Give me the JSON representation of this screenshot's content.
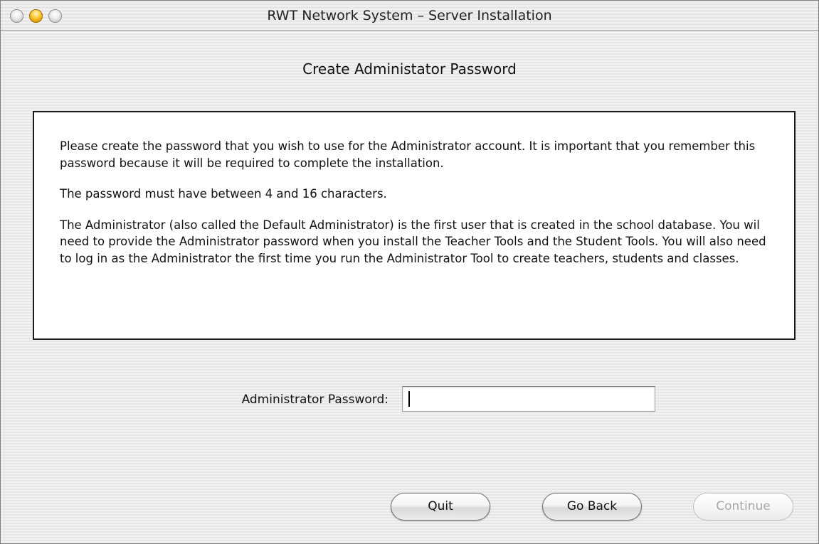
{
  "window": {
    "title": "RWT Network System – Server Installation"
  },
  "page": {
    "title": "Create Administator Password"
  },
  "info": {
    "paragraphs": [
      "Please create the password that you wish to use for the Administrator account.  It is important that you remember this password because it will be required to complete the installation.",
      "The password must have between 4 and 16 characters.",
      "The Administrator (also called the Default Administrator) is the first user that is created in the school database.  You wil need to provide the Administrator password when you install the Teacher Tools and the Student Tools.  You will also need to log in as the Administrator the first time you run the Administrator Tool to create teachers, students and classes."
    ]
  },
  "form": {
    "password_label": "Administrator Password:",
    "password_value": ""
  },
  "buttons": {
    "quit": "Quit",
    "go_back": "Go Back",
    "continue": "Continue"
  },
  "colors": {
    "minimize_button": "#ffc21f",
    "disabled_text": "#a8a8a8",
    "info_border": "#1a1a1a"
  }
}
